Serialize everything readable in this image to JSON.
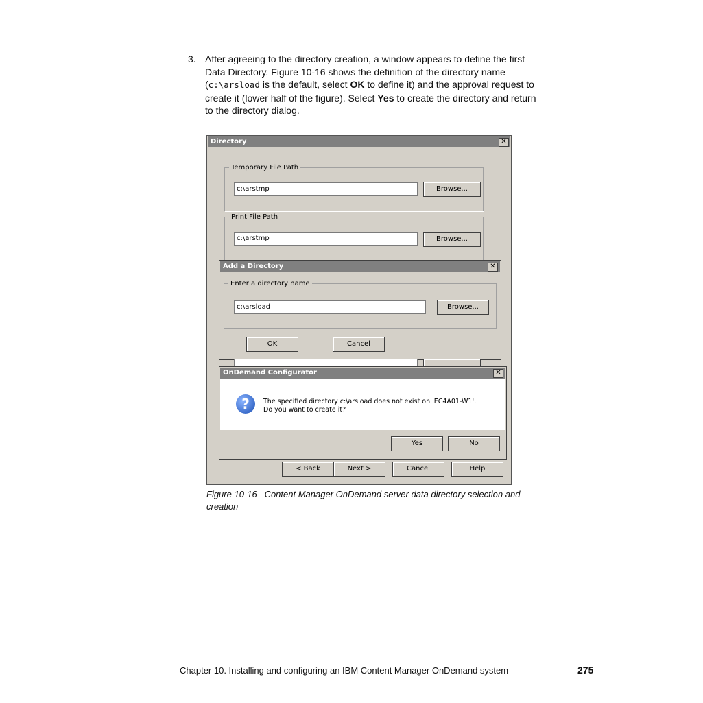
{
  "paragraph": {
    "number": "3.",
    "line1": "After agreeing to the directory creation, a window appears to define the first",
    "line2": "Data Directory. Figure 10-16 shows the definition of the directory name",
    "line3_a": "(",
    "line3_code": "c:\\arsload",
    "line3_b": " is the default, select ",
    "line3_bold": "OK",
    "line3_c": " to define it) and the approval request to",
    "line4_a": "create it (lower half of the figure). Select ",
    "line4_bold": "Yes",
    "line4_b": " to create the directory and return",
    "line5": "to the directory dialog."
  },
  "directory_window": {
    "title": "Directory",
    "close": "✕",
    "temp_group_label": "Temporary File Path",
    "temp_value": "c:\\arstmp",
    "temp_browse": "Browse...",
    "print_group_label": "Print File Path",
    "print_value": "c:\\arstmp",
    "print_browse": "Browse...",
    "back": "< Back",
    "next": "Next >",
    "cancel": "Cancel",
    "help": "Help"
  },
  "add_dialog": {
    "title": "Add a Directory",
    "close": "✕",
    "group_label": "Enter a directory name",
    "value": "c:\\arsload",
    "browse": "Browse...",
    "ok": "OK",
    "cancel": "Cancel"
  },
  "confirm_dialog": {
    "title": "OnDemand Configurator",
    "close": "✕",
    "icon_glyph": "?",
    "message_line1": "The specified directory c:\\arsload does not exist on 'EC4A01-W1'.",
    "message_line2": "Do you want to create it?",
    "yes": "Yes",
    "no": "No"
  },
  "caption": {
    "label": "Figure 10-16",
    "text": "Content Manager OnDemand server data directory selection and",
    "text2": "creation"
  },
  "footer": {
    "chapter": "Chapter 10. Installing and configuring an IBM Content Manager OnDemand system",
    "page": "275"
  },
  "colors": {
    "dialog_face": "#d4d0c8",
    "titlebar": "#808080",
    "question_icon": "#1a4fb5"
  }
}
